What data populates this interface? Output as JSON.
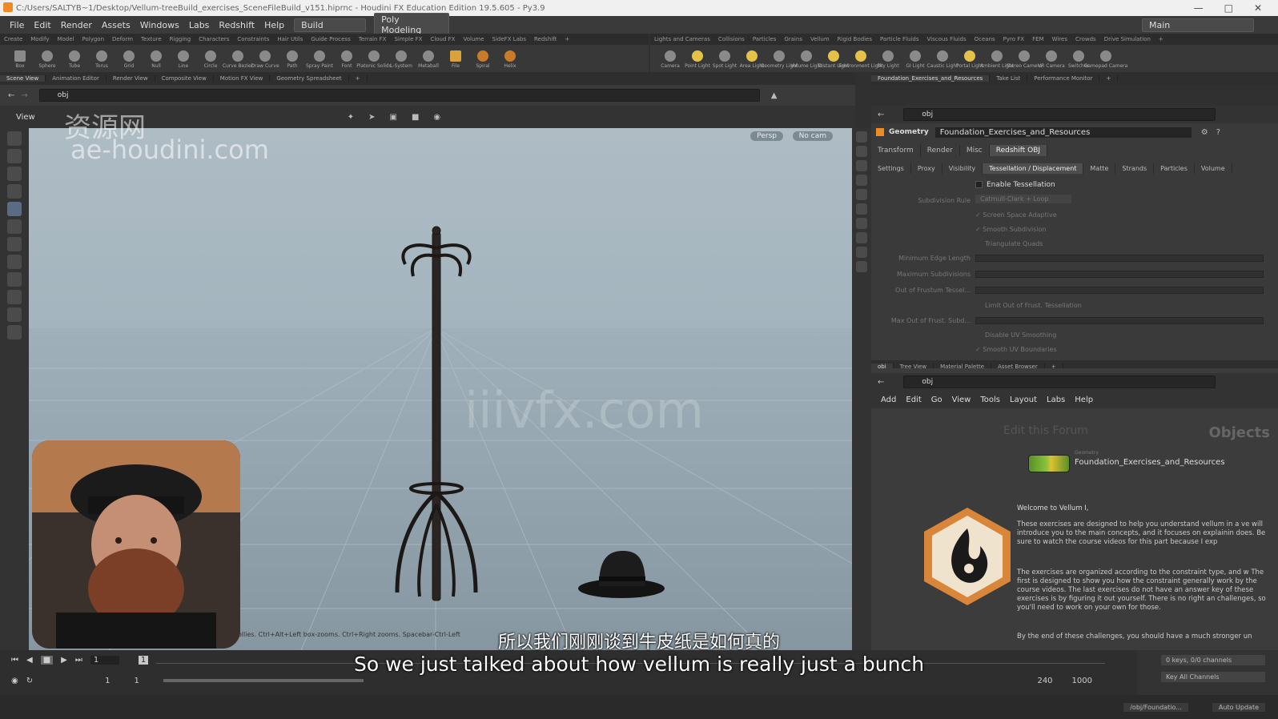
{
  "window": {
    "path": "C:/Users/SALTYB~1/Desktop/Vellum-treeBuild_exercises_SceneFileBuild_v151.hiprnc - Houdini FX Education Edition 19.5.605 - Py3.9"
  },
  "menubar": {
    "items": [
      "File",
      "Edit",
      "Render",
      "Assets",
      "Windows",
      "Labs",
      "Redshift",
      "Help"
    ],
    "build": "Build",
    "desktop": "Poly Modeling",
    "main": "Main"
  },
  "shelf_left": {
    "tabs": [
      "Create",
      "Modify",
      "Model",
      "Polygon",
      "Deform",
      "Texture",
      "Rigging",
      "Characters",
      "Constraints",
      "Hair Utils",
      "Guide Process",
      "Terrain FX",
      "Simple FX",
      "Cloud FX",
      "Volume",
      "SideFX Labs",
      "Redshift"
    ],
    "tools": [
      "Box",
      "Sphere",
      "Tube",
      "Torus",
      "Grid",
      "Null",
      "Line",
      "Circle",
      "Curve Bezier",
      "Draw Curve",
      "Path",
      "Spray Paint",
      "Font",
      "Platonic Solids",
      "L-System",
      "Metaball",
      "File",
      "Spiral",
      "Helix"
    ]
  },
  "shelf_right": {
    "tabs": [
      "Lights and Cameras",
      "Collisions",
      "Particles",
      "Grains",
      "Vellum",
      "Rigid Bodies",
      "Particle Fluids",
      "Viscous Fluids",
      "Oceans",
      "Pyro FX",
      "FEM",
      "Wires",
      "Crowds",
      "Drive Simulation"
    ],
    "tools": [
      "Camera",
      "Point Light",
      "Spot Light",
      "Area Light",
      "Geometry Light",
      "Volume Light",
      "Distant Light",
      "Environment Light",
      "Sky Light",
      "GI Light",
      "Caustic Light",
      "Portal Light",
      "Ambient Light",
      "Stereo Camera",
      "VR Camera",
      "Switcher",
      "Gamepad Camera"
    ]
  },
  "pane_tabs_left": [
    "Scene View",
    "Animation Editor",
    "Render View",
    "Composite View",
    "Motion FX View",
    "Geometry Spreadsheet"
  ],
  "pane_tabs_right": [
    "Foundation_Exercises_and_Resources",
    "Take List",
    "Performance Monitor"
  ],
  "viewer": {
    "path": "obj",
    "view_label": "View",
    "persp": "Persp",
    "cam": "No cam",
    "hint": "ght dollies. Ctrl+Alt+Left box-zooms. Ctrl+Right zooms. Spacebar-Ctrl-Left"
  },
  "param": {
    "path": "obj",
    "node_type": "Geometry",
    "node_name": "Foundation_Exercises_and_Resources",
    "top_tabs": [
      "Transform",
      "Render",
      "Misc",
      "Redshift OBJ"
    ],
    "sub_tabs": [
      "Settings",
      "Proxy",
      "Visibility",
      "Tessellation / Displacement",
      "Matte",
      "Strands",
      "Particles",
      "Volume"
    ],
    "enable_tess": "Enable Tessellation",
    "subdiv_rule_label": "Subdivision Rule",
    "subdiv_rule_value": "Catmull-Clark + Loop",
    "screen_space": "Screen Space Adaptive",
    "smooth_subdiv": "Smooth Subdivision",
    "triangulate": "Triangulate Quads",
    "min_edge": "Minimum Edge Length",
    "max_subdiv": "Maximum Subdivisions",
    "out_frustum": "Out of Frustum Tessel...",
    "limit_frustum": "Limit Out of Frust. Tessellation",
    "max_out": "Max Out of Frust. Subd...",
    "disable_uv": "Disable UV Smoothing",
    "smooth_uv": "Smooth UV Boundaries"
  },
  "net": {
    "tabs": [
      "obj",
      "Tree View",
      "Material Palette",
      "Asset Browser"
    ],
    "path": "obj",
    "menu": [
      "Add",
      "Edit",
      "Go",
      "View",
      "Tools",
      "Layout",
      "Labs",
      "Help"
    ],
    "context": "Objects",
    "faint_title": "Edit this Forum",
    "node_type": "Geometry",
    "node_name": "Foundation_Exercises_and_Resources",
    "welcome": "Welcome to Vellum I,",
    "p1": "These exercises are designed to help you understand vellum in a ve will introduce you to the main concepts, and it focuses on explainin does. Be sure to watch the course videos for this part because I exp",
    "p2": "The exercises are organized according to the constraint type, and w The first is designed to show you how the constraint generally work by the course videos. The last exercises do not have an answer key of these exercises is by figuring it out yourself. There is no right an challenges, so you'll need to work on your own for those.",
    "p3": "By the end of these challenges, you should have a much stronger un"
  },
  "timeline": {
    "frame": "1",
    "marker": "1",
    "start": "1",
    "start2": "1",
    "end": "240",
    "end2": "1000",
    "keys": "0 keys, 0/0 channels",
    "keyall": "Key All Channels"
  },
  "status": {
    "path": "/obj/Foundatio...",
    "auto": "Auto Update"
  },
  "subtitles": {
    "cn": "所以我们刚刚谈到牛皮纸是如何真的",
    "en": "So we just talked about how vellum is really just a bunch"
  },
  "watermarks": {
    "cn": "资源网",
    "site": "ae-houdini.com",
    "center": "iiivfx.com"
  },
  "colors": {
    "accent": "#f08a24",
    "viewport_sky": "#aebcc4",
    "panel": "#3a3a3a"
  }
}
